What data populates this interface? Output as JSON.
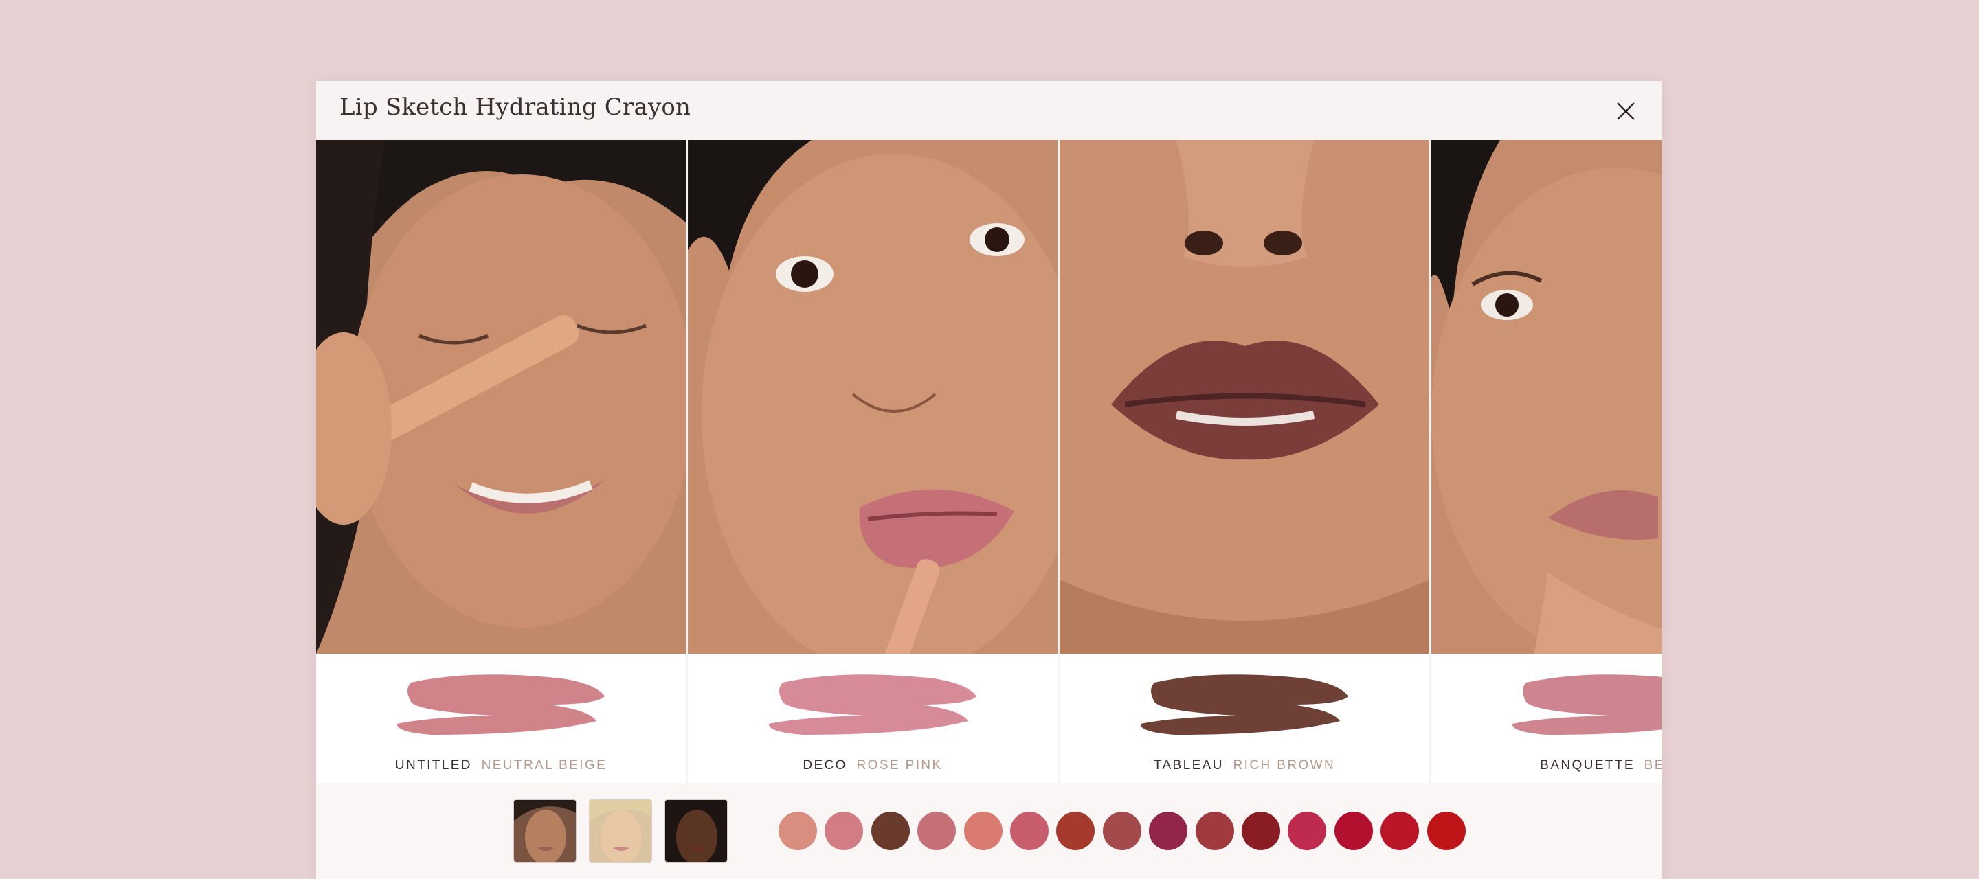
{
  "modal": {
    "title": "Lip Sketch Hydrating Crayon",
    "close_icon": "close-icon"
  },
  "slides": [
    {
      "name": "UNTITLED",
      "desc": "NEUTRAL BEIGE",
      "swatch_color": "#d0848a",
      "photo": "model-applying-crayon-to-nose"
    },
    {
      "name": "DECO",
      "desc": "ROSE PINK",
      "swatch_color": "#d78a98",
      "photo": "model-applying-crayon-to-lip"
    },
    {
      "name": "TABLEAU",
      "desc": "RICH BROWN",
      "swatch_color": "#6e4036",
      "photo": "lips-closeup-rich-brown"
    },
    {
      "name": "BANQUETTE",
      "desc": "BEIGE",
      "swatch_color": "#cf8590",
      "photo": "model-resting-chin-on-hand"
    }
  ],
  "thumbnails": [
    {
      "label": "model-medium-skin",
      "tone": "#b5805f"
    },
    {
      "label": "model-light-skin",
      "tone": "#e8c7a4"
    },
    {
      "label": "model-deep-skin",
      "tone": "#5a3524"
    }
  ],
  "color_dots": [
    "#da8e7f",
    "#d27c84",
    "#6a3a2c",
    "#c56f77",
    "#da7b70",
    "#c85d6e",
    "#a63b2d",
    "#a44a4c",
    "#93254a",
    "#a03a3e",
    "#891d23",
    "#bf2a4f",
    "#b30f2e",
    "#bb1528",
    "#bf1518"
  ]
}
